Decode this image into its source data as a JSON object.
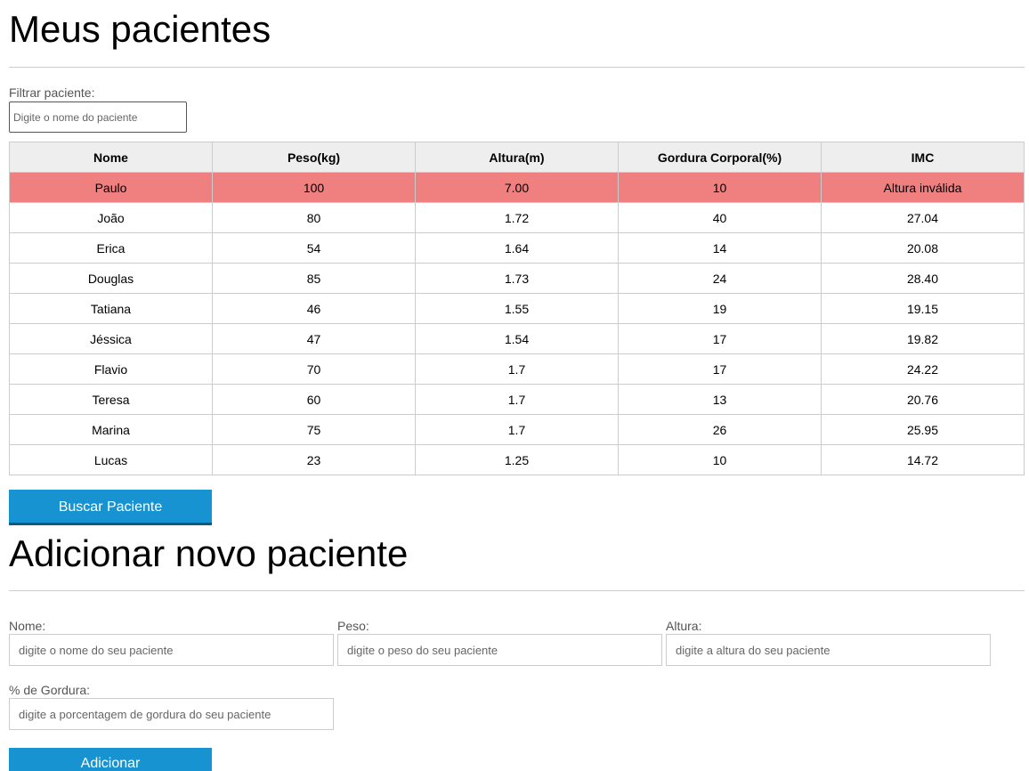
{
  "patients_section": {
    "title": "Meus pacientes",
    "filter_label": "Filtrar paciente:",
    "filter_placeholder": "Digite o nome do paciente",
    "table": {
      "headers": [
        "Nome",
        "Peso(kg)",
        "Altura(m)",
        "Gordura Corporal(%)",
        "IMC"
      ],
      "rows": [
        {
          "nome": "Paulo",
          "peso": "100",
          "altura": "7.00",
          "gordura": "10",
          "imc": "Altura inválida"
        },
        {
          "nome": "João",
          "peso": "80",
          "altura": "1.72",
          "gordura": "40",
          "imc": "27.04"
        },
        {
          "nome": "Erica",
          "peso": "54",
          "altura": "1.64",
          "gordura": "14",
          "imc": "20.08"
        },
        {
          "nome": "Douglas",
          "peso": "85",
          "altura": "1.73",
          "gordura": "24",
          "imc": "28.40"
        },
        {
          "nome": "Tatiana",
          "peso": "46",
          "altura": "1.55",
          "gordura": "19",
          "imc": "19.15"
        },
        {
          "nome": "Jéssica",
          "peso": "47",
          "altura": "1.54",
          "gordura": "17",
          "imc": "19.82"
        },
        {
          "nome": "Flavio",
          "peso": "70",
          "altura": "1.7",
          "gordura": "17",
          "imc": "24.22"
        },
        {
          "nome": "Teresa",
          "peso": "60",
          "altura": "1.7",
          "gordura": "13",
          "imc": "20.76"
        },
        {
          "nome": "Marina",
          "peso": "75",
          "altura": "1.7",
          "gordura": "26",
          "imc": "25.95"
        },
        {
          "nome": "Lucas",
          "peso": "23",
          "altura": "1.25",
          "gordura": "10",
          "imc": "14.72"
        }
      ]
    },
    "search_button_label": "Buscar Paciente"
  },
  "add_section": {
    "title": "Adicionar novo paciente",
    "fields": {
      "nome": {
        "label": "Nome:",
        "placeholder": "digite o nome do seu paciente"
      },
      "peso": {
        "label": "Peso:",
        "placeholder": "digite o peso do seu paciente"
      },
      "altura": {
        "label": "Altura:",
        "placeholder": "digite a altura do seu paciente"
      },
      "gordura": {
        "label": "% de Gordura:",
        "placeholder": "digite a porcentagem de gordura do seu paciente"
      }
    },
    "add_button_label": "Adicionar"
  },
  "colors": {
    "invalid_row": "#f08080",
    "button": "#1793d1",
    "header_bg": "#eeeeee"
  }
}
